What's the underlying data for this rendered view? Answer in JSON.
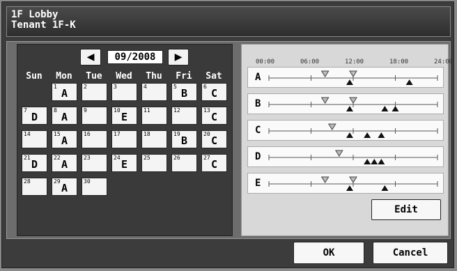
{
  "window": {
    "title_line1": "1F Lobby",
    "title_line2": "Tenant 1F-K"
  },
  "calendar": {
    "month": "09/2008",
    "prev_icon": "◀",
    "next_icon": "▶",
    "weekdays": [
      "Sun",
      "Mon",
      "Tue",
      "Wed",
      "Thu",
      "Fri",
      "Sat"
    ],
    "days": [
      {
        "num": "1",
        "code": "A"
      },
      {
        "num": "2",
        "code": ""
      },
      {
        "num": "3",
        "code": ""
      },
      {
        "num": "4",
        "code": ""
      },
      {
        "num": "5",
        "code": "B"
      },
      {
        "num": "6",
        "code": "C"
      },
      {
        "num": "7",
        "code": "D"
      },
      {
        "num": "8",
        "code": "A"
      },
      {
        "num": "9",
        "code": ""
      },
      {
        "num": "10",
        "code": "E"
      },
      {
        "num": "11",
        "code": ""
      },
      {
        "num": "12",
        "code": ""
      },
      {
        "num": "13",
        "code": "C"
      },
      {
        "num": "14",
        "code": ""
      },
      {
        "num": "15",
        "code": "A"
      },
      {
        "num": "16",
        "code": ""
      },
      {
        "num": "17",
        "code": ""
      },
      {
        "num": "18",
        "code": ""
      },
      {
        "num": "19",
        "code": "B"
      },
      {
        "num": "20",
        "code": "C"
      },
      {
        "num": "21",
        "code": "D"
      },
      {
        "num": "22",
        "code": "A"
      },
      {
        "num": "23",
        "code": ""
      },
      {
        "num": "24",
        "code": "E"
      },
      {
        "num": "25",
        "code": ""
      },
      {
        "num": "26",
        "code": ""
      },
      {
        "num": "27",
        "code": "C"
      },
      {
        "num": "28",
        "code": ""
      },
      {
        "num": "29",
        "code": "A"
      },
      {
        "num": "30",
        "code": ""
      }
    ]
  },
  "schedule": {
    "hour_labels": [
      "00:00",
      "06:00",
      "12:00",
      "18:00",
      "24:00"
    ],
    "patterns": [
      {
        "label": "A",
        "on_hours": [
          8,
          12
        ],
        "off_hours": [
          11.5,
          20
        ]
      },
      {
        "label": "B",
        "on_hours": [
          8,
          12
        ],
        "off_hours": [
          11.5,
          16.5,
          18
        ]
      },
      {
        "label": "C",
        "on_hours": [
          9
        ],
        "off_hours": [
          11.5,
          14,
          16
        ]
      },
      {
        "label": "D",
        "on_hours": [
          10
        ],
        "off_hours": [
          14,
          15,
          16
        ]
      },
      {
        "label": "E",
        "on_hours": [
          8,
          12
        ],
        "off_hours": [
          11.5,
          16.5
        ]
      }
    ]
  },
  "buttons": {
    "edit": "Edit",
    "ok": "OK",
    "cancel": "Cancel"
  }
}
